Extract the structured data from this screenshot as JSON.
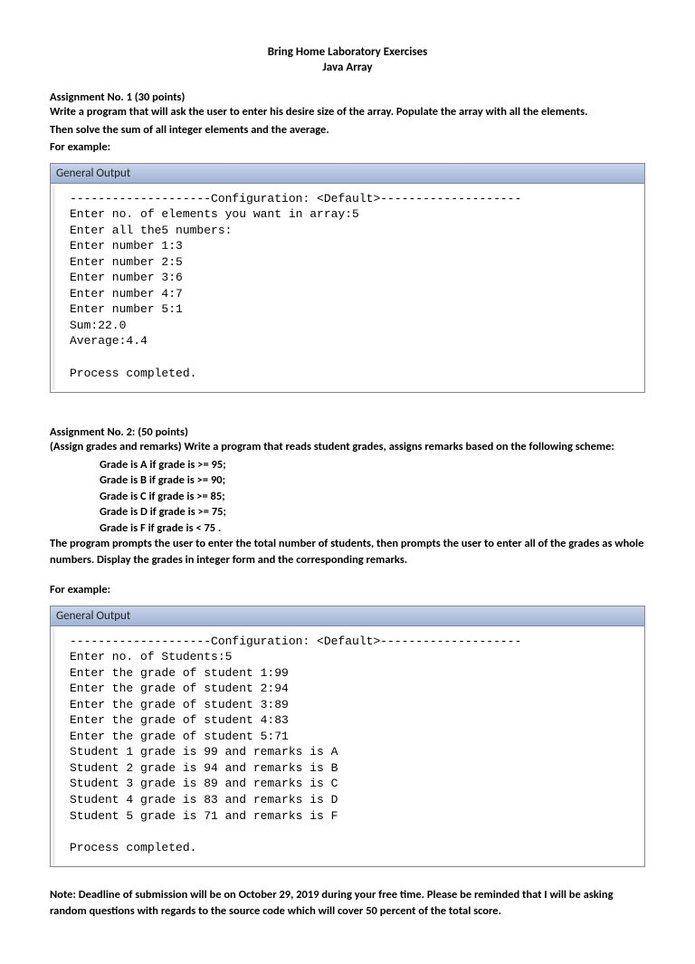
{
  "header": {
    "title": "Bring Home Laboratory Exercises",
    "subtitle": "Java Array"
  },
  "assignment1": {
    "heading": "Assignment No. 1 (30 points)",
    "desc1": "Write a program that will ask the user to enter his desire size of the array. Populate the array with all the elements.",
    "desc2": "Then solve the sum of all integer elements and the average.",
    "example_label": "For example:",
    "output_title": "General Output",
    "output_body": "--------------------Configuration: <Default>--------------------\nEnter no. of elements you want in array:5\nEnter all the5 numbers:\nEnter number 1:3\nEnter number 2:5\nEnter number 3:6\nEnter number 4:7\nEnter number 5:1\nSum:22.0\nAverage:4.4\n\nProcess completed."
  },
  "assignment2": {
    "heading": "Assignment No. 2: (50 points)",
    "desc1": "(Assign grades and remarks) Write a program that reads student grades, assigns remarks based on the following scheme:",
    "scheme": {
      "l1": "Grade is A if grade is >= 95;",
      "l2": "Grade is B if grade is >= 90;",
      "l3": "Grade is C if grade is >= 85;",
      "l4": "Grade is D if grade is >= 75;",
      "l5": "Grade is F if grade is <  75 ."
    },
    "desc2": "The program prompts the user to enter the total number of students, then prompts the user to enter all of the grades as whole numbers. Display the grades in integer form and the corresponding remarks.",
    "example_label": "For example:",
    "output_title": "General Output",
    "output_body": "--------------------Configuration: <Default>--------------------\nEnter no. of Students:5\nEnter the grade of student 1:99\nEnter the grade of student 2:94\nEnter the grade of student 3:89\nEnter the grade of student 4:83\nEnter the grade of student 5:71\nStudent 1 grade is 99 and remarks is A\nStudent 2 grade is 94 and remarks is B\nStudent 3 grade is 89 and remarks is C\nStudent 4 grade is 83 and remarks is D\nStudent 5 grade is 71 and remarks is F\n\nProcess completed."
  },
  "note": "Note: Deadline of submission will be on October 29, 2019 during your free time. Please be reminded that I will be asking random questions with regards to the source code which will cover 50 percent of the total score."
}
